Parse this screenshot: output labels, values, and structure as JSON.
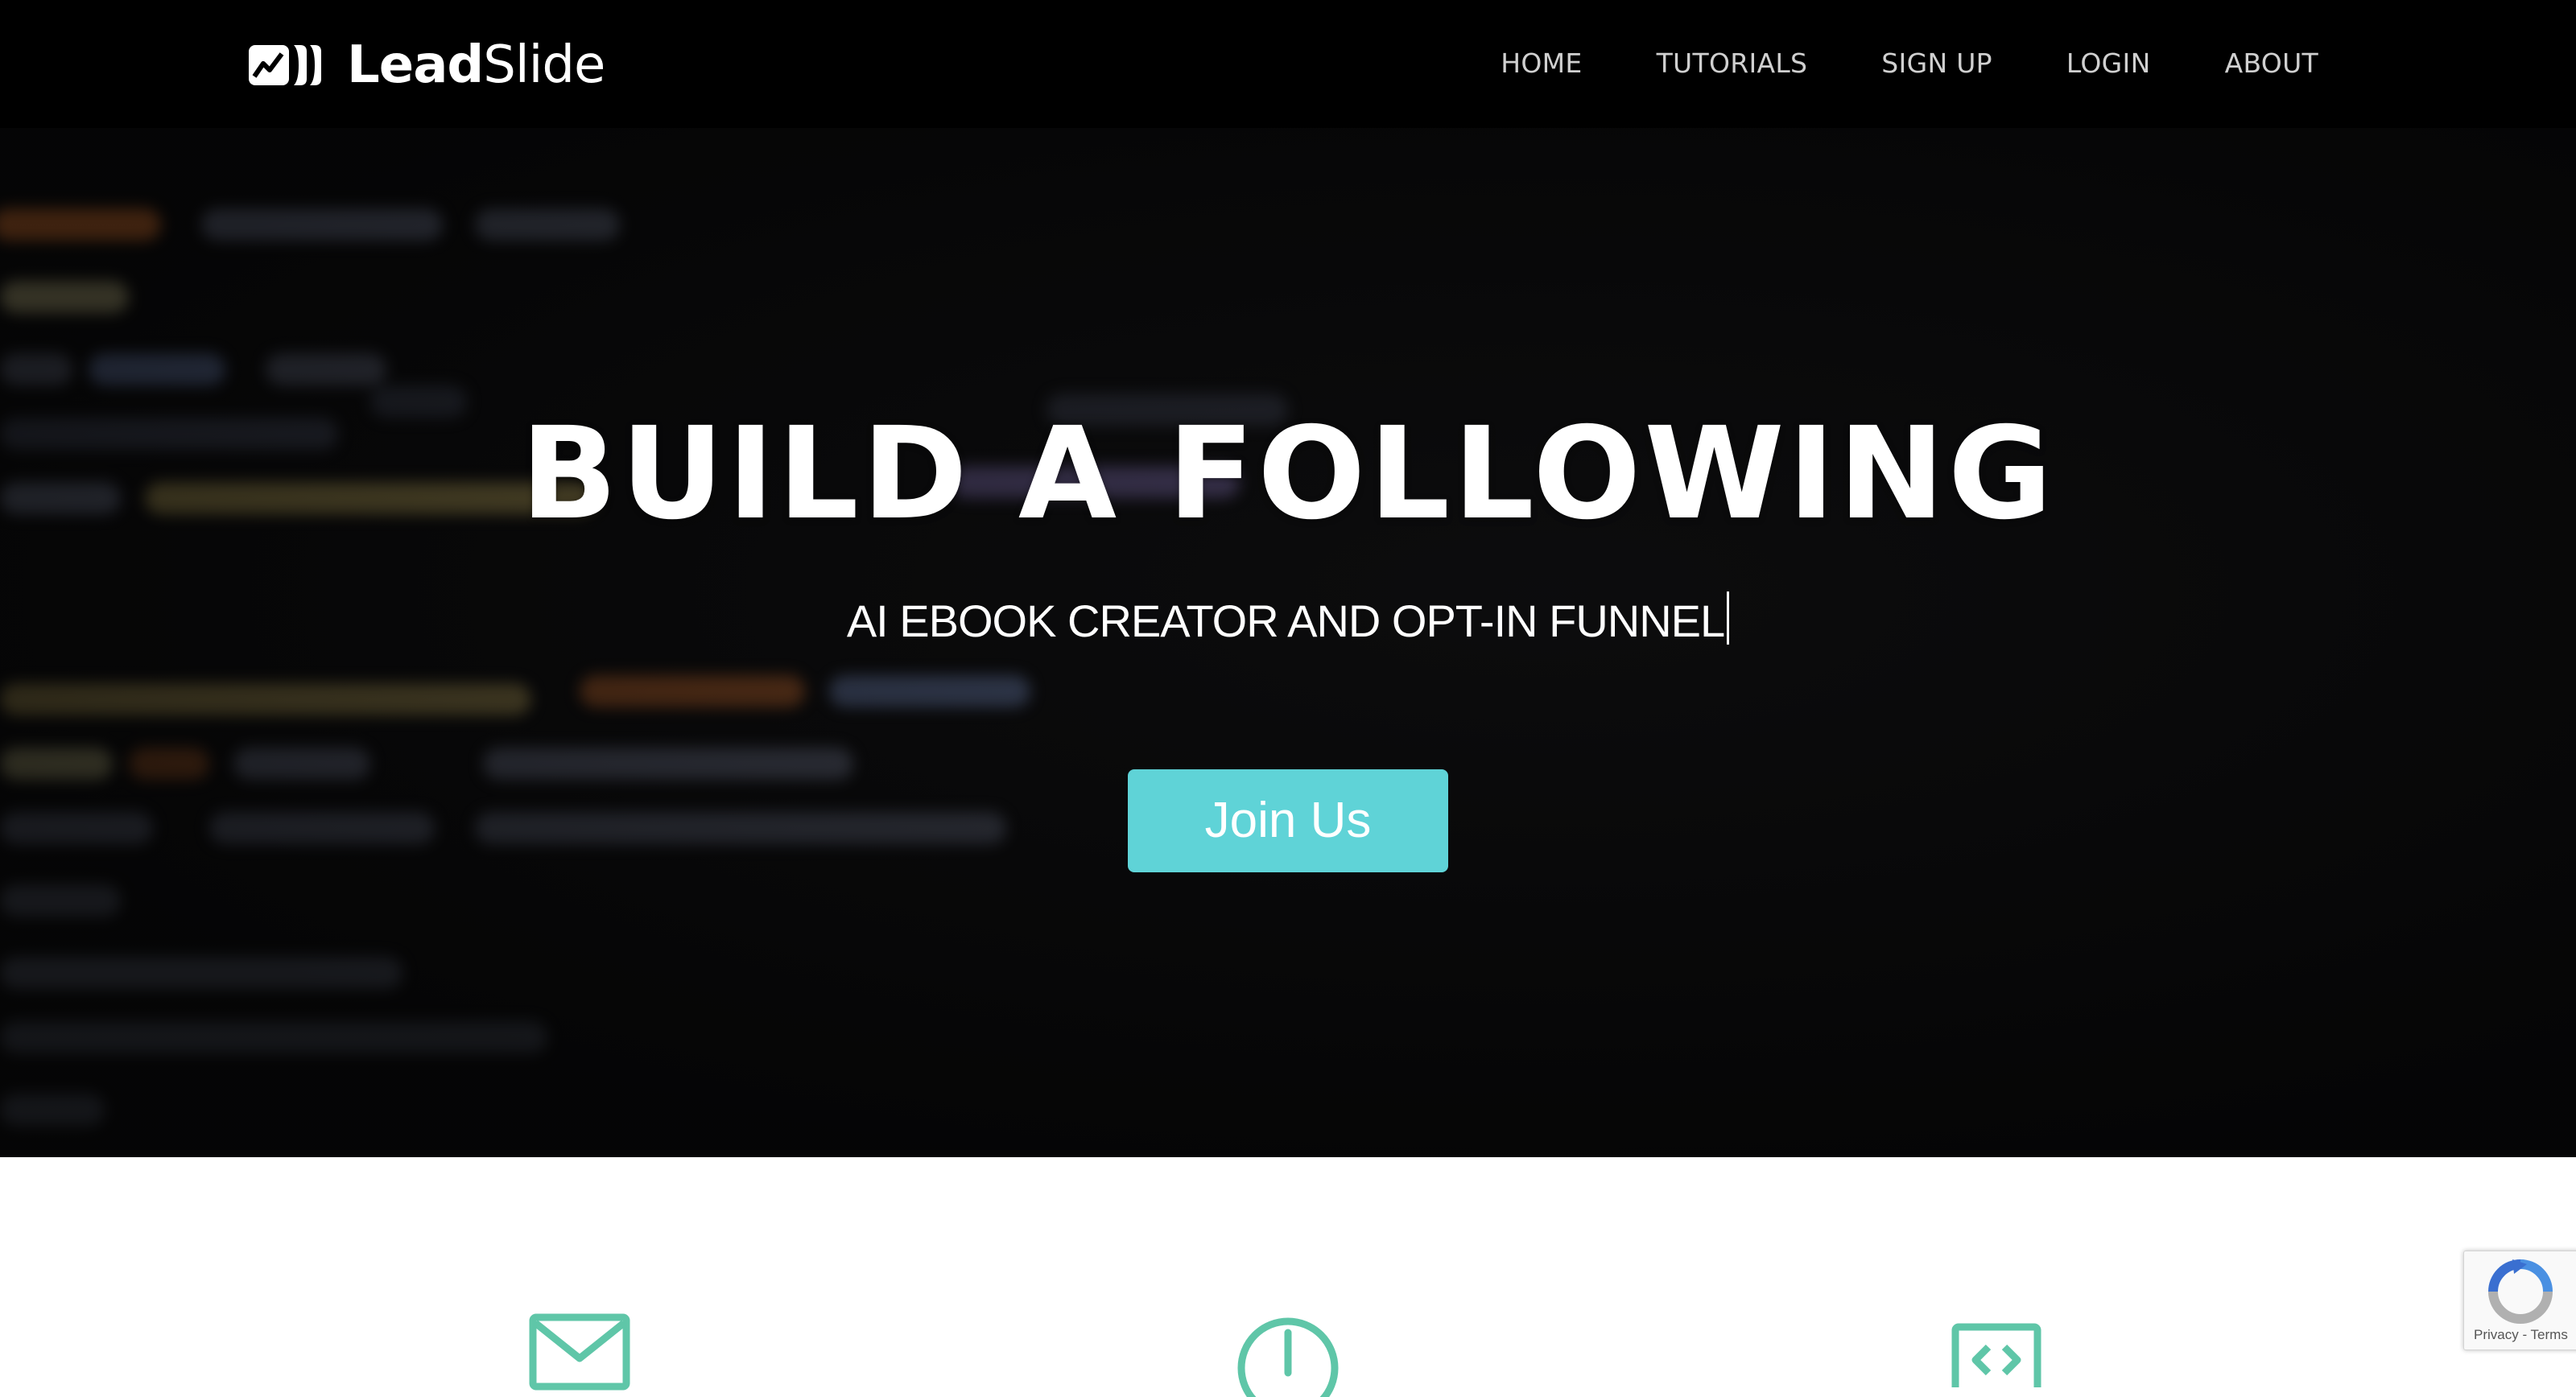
{
  "brand": {
    "name_bold": "Lead",
    "name_regular": "Slide",
    "logo_icon": "leadslide-logo-icon"
  },
  "nav": {
    "items": [
      {
        "label": "HOME"
      },
      {
        "label": "TUTORIALS"
      },
      {
        "label": "SIGN UP"
      },
      {
        "label": "LOGIN"
      },
      {
        "label": "ABOUT"
      }
    ]
  },
  "hero": {
    "title": "BUILD A FOLLOWING",
    "subtitle": "AI EBOOK CREATOR AND OPT-IN FUNNEL",
    "cta_label": "Join Us"
  },
  "features": {
    "icons": [
      "envelope-icon",
      "clock-icon",
      "code-icon"
    ],
    "icon_color": "#5fc6a8"
  },
  "recaptcha": {
    "privacy": "Privacy",
    "separator": " - ",
    "terms": "Terms"
  },
  "colors": {
    "accent": "#5fd3d7",
    "navbar_bg": "#000000",
    "hero_bg": "#0b0b0c"
  }
}
